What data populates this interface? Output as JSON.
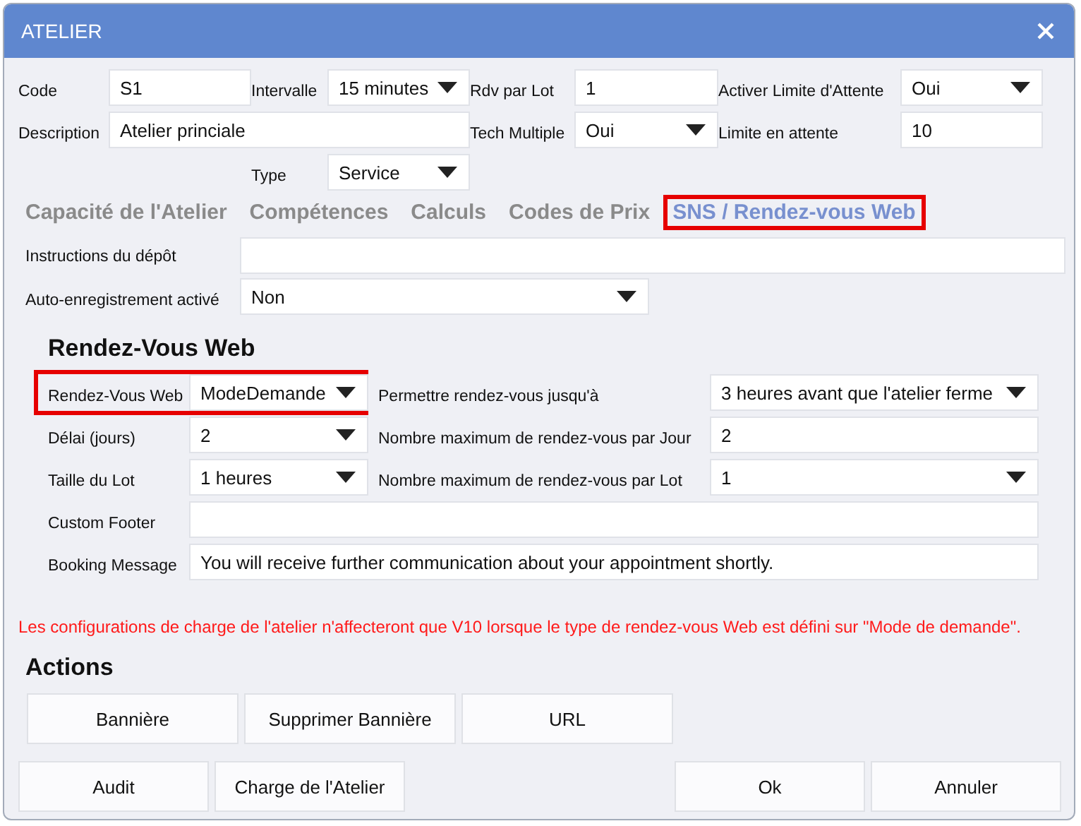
{
  "window": {
    "title": "ATELIER"
  },
  "header_fields": [
    {
      "label": "Code",
      "kind": "text",
      "value": "S1"
    },
    {
      "label": "Intervalle",
      "kind": "select",
      "value": "15 minutes"
    },
    {
      "label": "Rdv par Lot",
      "kind": "text",
      "value": "1"
    },
    {
      "label": "Activer Limite d'Attente",
      "kind": "select",
      "value": "Oui"
    },
    {
      "label": "Description",
      "kind": "text",
      "value": "Atelier princiale"
    },
    {
      "label": "Tech Multiple",
      "kind": "select",
      "value": "Oui"
    },
    {
      "label": "Limite en attente",
      "kind": "text",
      "value": "10"
    },
    {
      "label": "Type",
      "kind": "select",
      "value": "Service"
    }
  ],
  "tabs": [
    {
      "label": "Capacité de l'Atelier",
      "selected": false,
      "highlighted": false
    },
    {
      "label": "Compétences",
      "selected": false,
      "highlighted": false
    },
    {
      "label": "Calculs",
      "selected": false,
      "highlighted": false
    },
    {
      "label": "Codes de Prix",
      "selected": false,
      "highlighted": false
    },
    {
      "label": "SNS / Rendez-vous Web",
      "selected": true,
      "highlighted": true
    }
  ],
  "tab_fields": [
    {
      "label": "Instructions du dépôt",
      "kind": "text"
    },
    {
      "label": "Auto-enregistrement activé",
      "kind": "select",
      "value": "Non"
    }
  ],
  "web_section": {
    "heading": "Rendez-Vous Web",
    "fields": [
      {
        "label": "Rendez-Vous Web",
        "kind": "select",
        "value": "ModeDemande",
        "highlighted": true
      },
      {
        "label": "Permettre rendez-vous jusqu'à",
        "kind": "select",
        "value": "3 heures avant que l'atelier ferme"
      },
      {
        "label": "Délai (jours)",
        "kind": "select",
        "value": "2"
      },
      {
        "label": "Nombre maximum de rendez-vous par Jour",
        "kind": "text",
        "value": "2"
      },
      {
        "label": "Taille du Lot",
        "kind": "select",
        "value": "1 heures"
      },
      {
        "label": "Nombre maximum de rendez-vous par Lot",
        "kind": "select",
        "value": "1"
      },
      {
        "label": "Custom Footer",
        "kind": "text"
      },
      {
        "label": "Booking Message",
        "kind": "text",
        "value": "You will receive further communication about your appointment shortly."
      }
    ]
  },
  "notice": "Les configurations de charge de l'atelier n'affecteront que V10 lorsque le type de rendez-vous Web est défini sur \"Mode de demande\".",
  "actions": {
    "heading": "Actions",
    "buttons": [
      "Bannière",
      "Supprimer Bannière",
      "URL"
    ]
  },
  "footer_buttons_left": [
    "Audit",
    "Charge de l'Atelier"
  ],
  "footer_buttons_right": [
    "Ok",
    "Annuler"
  ]
}
